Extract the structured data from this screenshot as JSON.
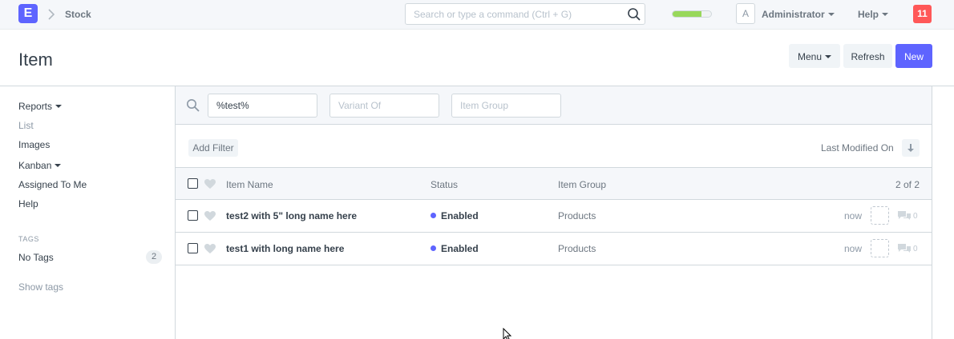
{
  "navbar": {
    "logo_letter": "E",
    "breadcrumb": "Stock",
    "search_placeholder": "Search or type a command (Ctrl + G)",
    "progress_fraction": 0.75,
    "avatar_letter": "A",
    "user_name": "Administrator",
    "help_label": "Help",
    "notification_count": "11"
  },
  "page": {
    "title": "Item",
    "menu_label": "Menu",
    "refresh_label": "Refresh",
    "new_label": "New"
  },
  "sidebar": {
    "items": [
      "Reports",
      "List",
      "Images",
      "Kanban",
      "Assigned To Me",
      "Help"
    ],
    "tags_heading": "TAGS",
    "no_tags_label": "No Tags",
    "no_tags_count": "2",
    "show_tags": "Show tags"
  },
  "filters": {
    "name_value": "%test%",
    "variant_placeholder": "Variant Of",
    "group_placeholder": "Item Group",
    "add_filter": "Add Filter",
    "sort_label": "Last Modified On"
  },
  "table": {
    "headers": {
      "name": "Item Name",
      "status": "Status",
      "group": "Item Group",
      "count": "2 of 2"
    },
    "rows": [
      {
        "name": "test2 with 5\" long name here",
        "status": "Enabled",
        "group": "Products",
        "modified": "now",
        "comments": "0"
      },
      {
        "name": "test1 with long name here",
        "status": "Enabled",
        "group": "Products",
        "modified": "now",
        "comments": "0"
      }
    ]
  },
  "colors": {
    "accent": "#5e64ff",
    "notification": "#ff5858",
    "progress": "#98d85b"
  }
}
